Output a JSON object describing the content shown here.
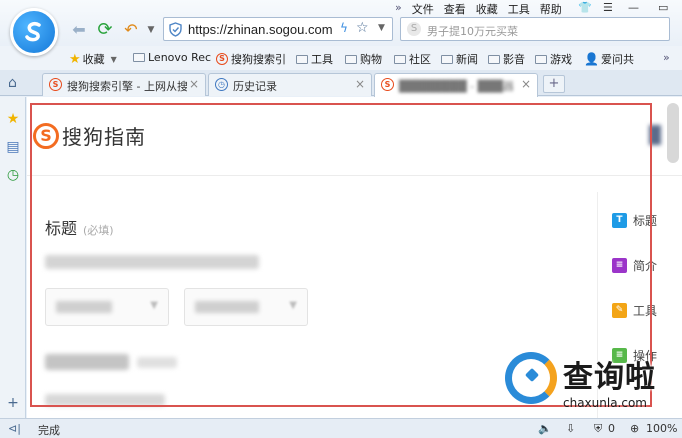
{
  "menu": {
    "collapse": "»",
    "items": [
      "文件",
      "查看",
      "收藏",
      "工具",
      "帮助"
    ]
  },
  "nav": {
    "url": "https://zhinan.sogou.com",
    "search_placeholder": "男子提10万元买菜"
  },
  "bookmarks": {
    "collapse": "»",
    "items": [
      {
        "label": "收藏",
        "type": "star"
      },
      {
        "label": "Lenovo Rec",
        "type": "folder"
      },
      {
        "label": "搜狗搜索引",
        "type": "sogou"
      },
      {
        "label": "工具",
        "type": "folder"
      },
      {
        "label": "购物",
        "type": "folder"
      },
      {
        "label": "社区",
        "type": "folder"
      },
      {
        "label": "新闻",
        "type": "folder"
      },
      {
        "label": "影音",
        "type": "folder"
      },
      {
        "label": "游戏",
        "type": "folder"
      },
      {
        "label": "爱问共",
        "type": "person"
      }
    ]
  },
  "tabs": [
    {
      "label": "搜狗搜索引擎 - 上网从搜",
      "close": "×"
    },
    {
      "label": "历史记录",
      "close": "×"
    },
    {
      "label": "████████ - ███器",
      "close": "×"
    }
  ],
  "new_tab": "+",
  "page": {
    "brand": "搜狗指南",
    "brand_glyph": "S",
    "title": "标题",
    "title_required": "(必填)",
    "right_panel": [
      {
        "label": "标题",
        "glyph": "T",
        "color": "#1e9be6"
      },
      {
        "label": "简介",
        "glyph": "≡",
        "color": "#9b35c9"
      },
      {
        "label": "工具",
        "glyph": "✎",
        "color": "#f3a516"
      },
      {
        "label": "操作",
        "glyph": "≡",
        "color": "#57b84a"
      }
    ]
  },
  "watermark": {
    "text": "查询啦",
    "url": "chaxunla.com"
  },
  "status": {
    "text": "完成",
    "count": "0",
    "zoom": "100%"
  }
}
